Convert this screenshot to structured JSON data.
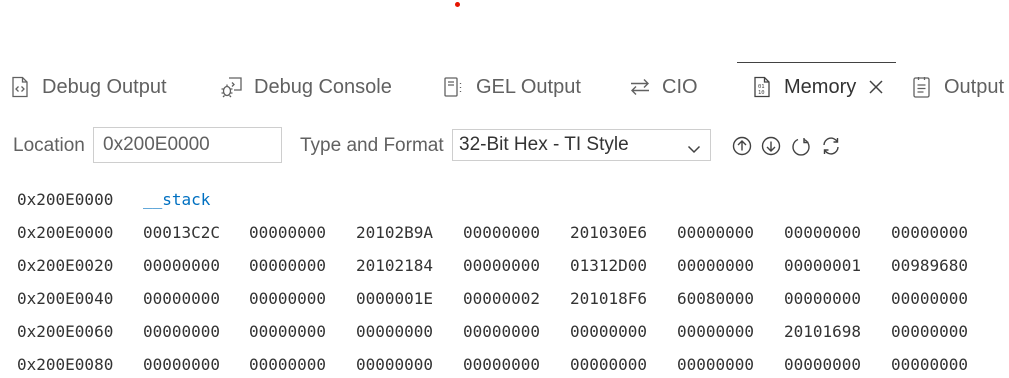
{
  "tabs": [
    {
      "label": "Debug Output",
      "icon": "debug-output-icon"
    },
    {
      "label": "Debug Console",
      "icon": "debug-console-icon"
    },
    {
      "label": "GEL Output",
      "icon": "gel-output-icon"
    },
    {
      "label": "CIO",
      "icon": "arrows-exchange-icon"
    },
    {
      "label": "Memory",
      "icon": "memory-icon",
      "active": true
    },
    {
      "label": "Output",
      "icon": "output-icon"
    }
  ],
  "toolbar": {
    "location_label": "Location",
    "location_value": "0x200E0000",
    "type_format_label": "Type and Format",
    "type_format_value": "32-Bit Hex - TI Style",
    "buttons": [
      "arrow-up-circle-icon",
      "arrow-down-circle-icon",
      "refresh-icon",
      "sync-icon"
    ]
  },
  "memory": {
    "symbol_row": {
      "address": "0x200E0000",
      "symbol": "__stack"
    },
    "rows": [
      {
        "address": "0x200E0000",
        "values": [
          "00013C2C",
          "00000000",
          "20102B9A",
          "00000000",
          "201030E6",
          "00000000",
          "00000000",
          "00000000"
        ]
      },
      {
        "address": "0x200E0020",
        "values": [
          "00000000",
          "00000000",
          "20102184",
          "00000000",
          "01312D00",
          "00000000",
          "00000001",
          "00989680"
        ]
      },
      {
        "address": "0x200E0040",
        "values": [
          "00000000",
          "00000000",
          "0000001E",
          "00000002",
          "201018F6",
          "60080000",
          "00000000",
          "00000000"
        ]
      },
      {
        "address": "0x200E0060",
        "values": [
          "00000000",
          "00000000",
          "00000000",
          "00000000",
          "00000000",
          "00000000",
          "20101698",
          "00000000"
        ]
      },
      {
        "address": "0x200E0080",
        "values": [
          "00000000",
          "00000000",
          "00000000",
          "00000000",
          "00000000",
          "00000000",
          "00000000",
          "00000000"
        ]
      }
    ]
  },
  "colors": {
    "accent_symbol": "#0070c1",
    "indicator_dot": "#e51400"
  }
}
